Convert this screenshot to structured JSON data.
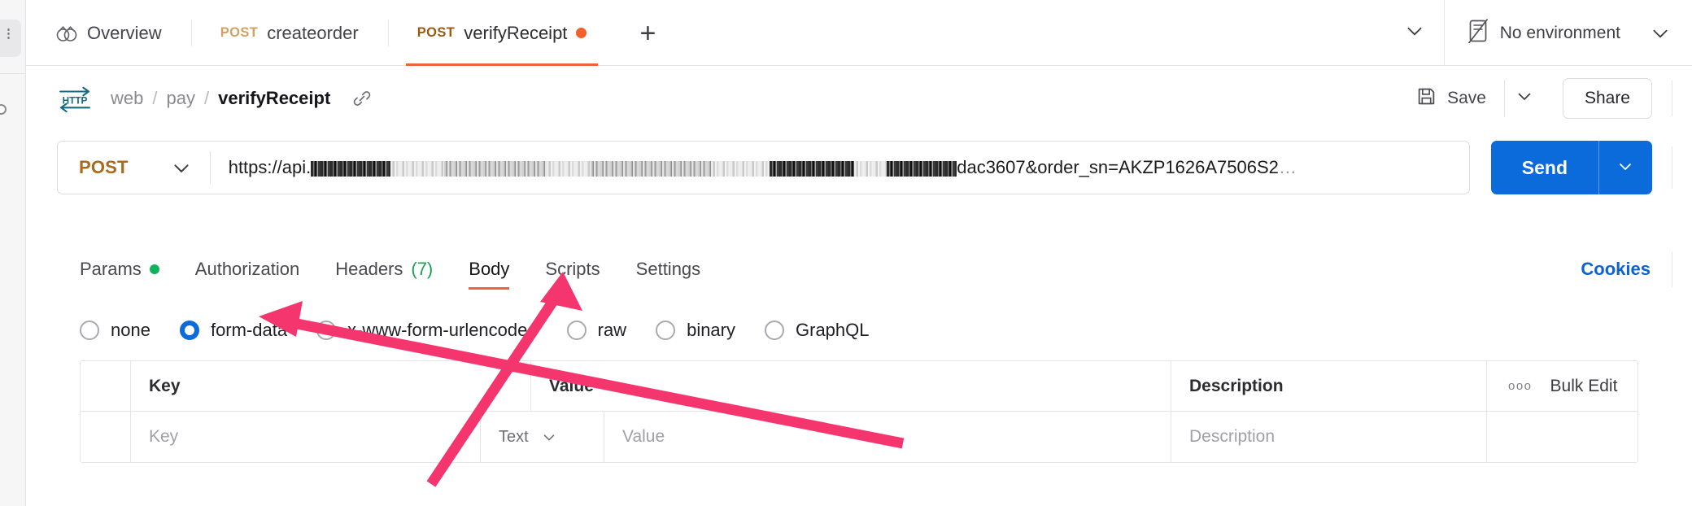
{
  "window": {
    "tabs": [
      {
        "label": "Overview",
        "icon": "overview-icon",
        "method": "",
        "active": false,
        "unsaved": false
      },
      {
        "label": "createorder",
        "icon": "",
        "method": "POST",
        "active": false,
        "unsaved": false
      },
      {
        "label": "verifyReceipt",
        "icon": "",
        "method": "POST",
        "active": true,
        "unsaved": true
      }
    ],
    "new_tab_label": "+",
    "tabs_caret": "chevron-down-icon",
    "environment": {
      "label": "No environment",
      "icon": "no-environment-icon",
      "caret": "chevron-down-icon"
    }
  },
  "breadcrumb": {
    "protocol_badge": "HTTP",
    "items": [
      "web",
      "pay"
    ],
    "separator": "/",
    "current": "verifyReceipt",
    "link_icon": "link-icon"
  },
  "actions": {
    "save_label": "Save",
    "save_icon": "save-disk-icon",
    "save_caret": "chevron-down-icon",
    "share_label": "Share"
  },
  "request": {
    "method": "POST",
    "method_caret": "chevron-down-icon",
    "url_prefix": "https://api.",
    "url_tail": "dac3607&order_sn=AKZP1626A7506S2",
    "url_ellipsis": "…",
    "send_label": "Send",
    "send_caret": "chevron-down-icon"
  },
  "request_tabs": {
    "items": [
      {
        "label": "Params",
        "badge_dot": true,
        "count": "",
        "active": false
      },
      {
        "label": "Authorization",
        "badge_dot": false,
        "count": "",
        "active": false
      },
      {
        "label": "Headers",
        "badge_dot": false,
        "count": "(7)",
        "active": false
      },
      {
        "label": "Body",
        "badge_dot": false,
        "count": "",
        "active": true
      },
      {
        "label": "Scripts",
        "badge_dot": false,
        "count": "",
        "active": false
      },
      {
        "label": "Settings",
        "badge_dot": false,
        "count": "",
        "active": false
      }
    ],
    "cookies_label": "Cookies"
  },
  "body_types": [
    {
      "label": "none",
      "selected": false
    },
    {
      "label": "form-data",
      "selected": true
    },
    {
      "label": "x-www-form-urlencoded",
      "selected": false
    },
    {
      "label": "raw",
      "selected": false
    },
    {
      "label": "binary",
      "selected": false
    },
    {
      "label": "GraphQL",
      "selected": false
    }
  ],
  "table": {
    "headers": {
      "key": "Key",
      "value": "Value",
      "description": "Description",
      "bulk_edit": "Bulk Edit",
      "bulk_icon": "more-options-icon"
    },
    "rows": [
      {
        "key_placeholder": "Key",
        "type_value": "Text",
        "type_caret": "chevron-down-icon",
        "value_placeholder": "Value",
        "description_placeholder": "Description"
      }
    ]
  },
  "colors": {
    "accent_orange": "#f0623c",
    "send_blue": "#0b6bdb",
    "cookies_blue": "#0b63ce",
    "method_post": "#ab6a19",
    "badge_green": "#10b15b",
    "annotation_pink": "#f5356e",
    "http_badge": "#16697f"
  }
}
